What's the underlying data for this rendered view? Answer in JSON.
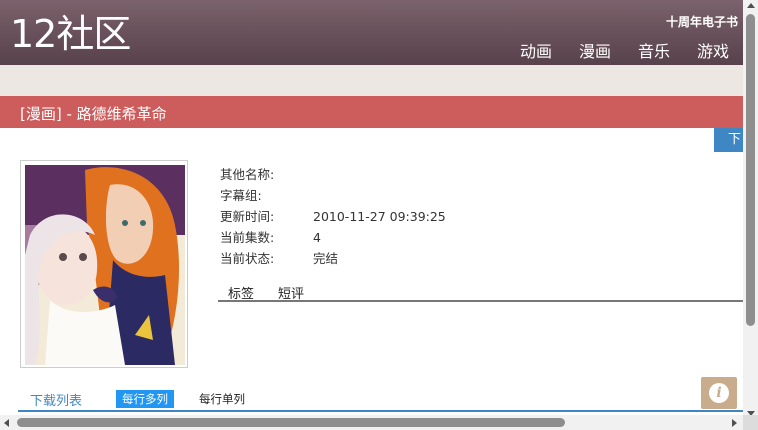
{
  "site": {
    "logo": "12社区",
    "anniversary_link": "十周年电子书"
  },
  "nav": {
    "items": [
      "动画",
      "漫画",
      "音乐",
      "游戏"
    ]
  },
  "page": {
    "title": "[漫画] - 路德维希革命",
    "download_button": "下"
  },
  "info": {
    "rows": [
      {
        "label": "其他名称:",
        "value": ""
      },
      {
        "label": "字幕组:",
        "value": ""
      },
      {
        "label": "更新时间:",
        "value": "2010-11-27 09:39:25"
      },
      {
        "label": "当前集数:",
        "value": "4"
      },
      {
        "label": "当前状态:",
        "value": "完结"
      }
    ]
  },
  "tabs": {
    "tags": "标签",
    "reviews": "短评"
  },
  "downloads": {
    "label": "下载列表",
    "multi": "每行多列",
    "single": "每行单列"
  },
  "icons": {
    "info": "info-icon"
  },
  "colors": {
    "header": "#6a525b",
    "title_bar": "#cd5c5c",
    "accent": "#3f87c4",
    "active_toggle": "#2196f3",
    "info_button": "#c9ac8c"
  }
}
